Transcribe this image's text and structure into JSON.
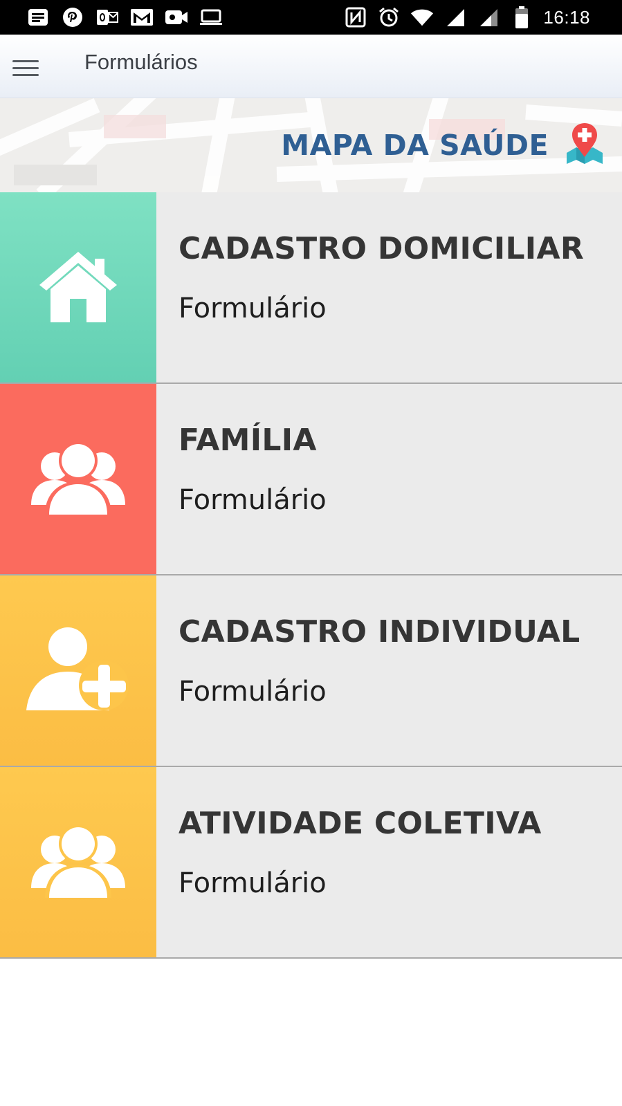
{
  "status_bar": {
    "time": "16:18",
    "left_icons": [
      "news-icon",
      "pinterest-icon",
      "outlook-icon",
      "gmail-icon",
      "video-camera-icon",
      "laptop-icon"
    ],
    "right_icons": [
      "nfc-icon",
      "alarm-icon",
      "wifi-icon",
      "signal-icon",
      "signal-icon-2",
      "battery-icon"
    ]
  },
  "app_bar": {
    "title": "Formulários",
    "menu_icon": "hamburger-menu-icon"
  },
  "banner": {
    "label": "MAPA DA SAÚDE",
    "icon": "health-map-pin-icon"
  },
  "forms": [
    {
      "title": "CADASTRO DOMICILIAR",
      "subtitle": "Formulário",
      "icon": "home-icon",
      "color": "#6dd8bb"
    },
    {
      "title": "FAMÍLIA",
      "subtitle": "Formulário",
      "icon": "group-icon",
      "color": "#fb6b5e"
    },
    {
      "title": "CADASTRO INDIVIDUAL",
      "subtitle": "Formulário",
      "icon": "add-person-icon",
      "color": "#fdc54a"
    },
    {
      "title": "ATIVIDADE COLETIVA",
      "subtitle": "Formulário",
      "icon": "group-icon",
      "color": "#fdc54a"
    }
  ]
}
